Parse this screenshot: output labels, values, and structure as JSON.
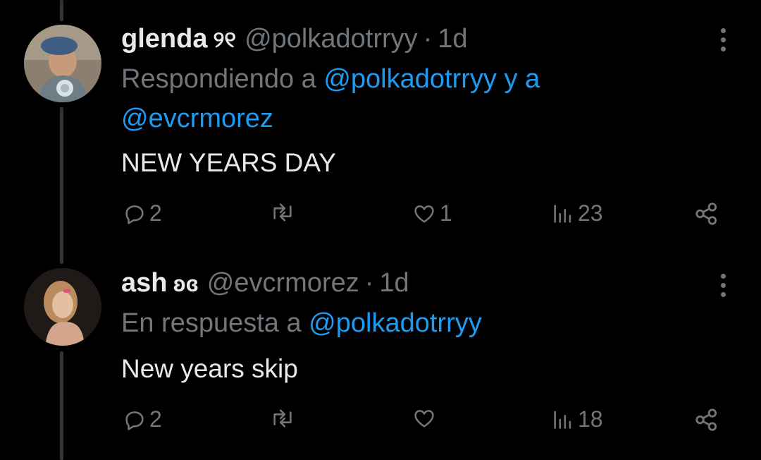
{
  "tweets": [
    {
      "display_name": "glenda",
      "name_emoji": "୨୧",
      "handle": "@polkadotrryy",
      "separator": "·",
      "time": "1d",
      "reply_prefix": "Respondiendo a",
      "reply_mentions": [
        "@polkadotrryy",
        "y a",
        "@evcrmorez"
      ],
      "text": "NEW YEARS DAY",
      "reply_count": "2",
      "like_count": "1",
      "view_count": "23"
    },
    {
      "display_name": "ash",
      "name_emoji": "ʚɞ",
      "handle": "@evcrmorez",
      "separator": "·",
      "time": "1d",
      "reply_prefix": "En respuesta a",
      "reply_mentions": [
        "@polkadotrryy"
      ],
      "text": "New years skip",
      "reply_count": "2",
      "like_count": "",
      "view_count": "18"
    }
  ],
  "icons": {
    "reply": "reply-icon",
    "retweet": "retweet-icon",
    "like": "heart-icon",
    "views": "views-icon",
    "share": "share-icon",
    "more": "more-icon"
  },
  "colors": {
    "background": "#000000",
    "text": "#e7e9ea",
    "muted": "#71767b",
    "link": "#1d9bf0",
    "thread_line": "#333639"
  }
}
